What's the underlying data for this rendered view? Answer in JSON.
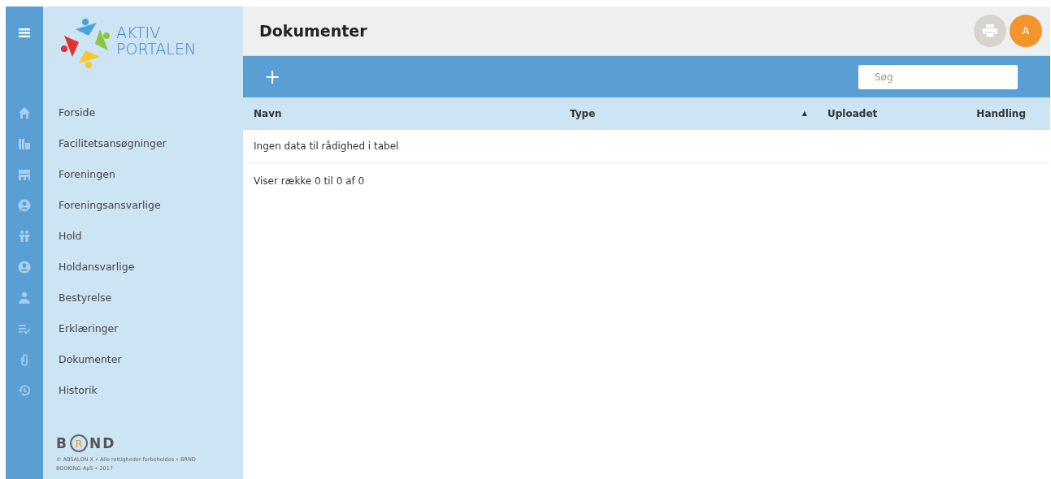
{
  "logo": {
    "line_1": "AKTIV",
    "line_2": "PORTALEN"
  },
  "sidebar": {
    "items": [
      {
        "label": "Forside"
      },
      {
        "label": "Facilitetsansøgninger"
      },
      {
        "label": "Foreningen"
      },
      {
        "label": "Foreningsansvarlige"
      },
      {
        "label": "Hold"
      },
      {
        "label": "Holdansvarlige"
      },
      {
        "label": "Bestyrelse"
      },
      {
        "label": "Erklæringer"
      },
      {
        "label": "Dokumenter"
      },
      {
        "label": "Historik"
      }
    ]
  },
  "footer": {
    "brand": {
      "before": "B",
      "circled": "R",
      "after": "ND"
    },
    "copyright": "© ABSALON X • Alle rettigheder forbeholdes • BRND BOOKING ApS • 2017"
  },
  "header": {
    "title": "Dokumenter",
    "avatar": "A"
  },
  "toolbar": {
    "add": "+",
    "search": {
      "placeholder": "Søg"
    }
  },
  "table": {
    "columns": [
      {
        "label": "Navn",
        "sorted": false
      },
      {
        "label": "Type",
        "sorted": true
      },
      {
        "label": "Uploadet",
        "sorted": false
      },
      {
        "label": "Handling",
        "sorted": false
      }
    ],
    "sort_indicator": "▲",
    "empty_message": "Ingen data til rådighed i tabel",
    "info": "Viser række 0 til 0 af 0"
  }
}
